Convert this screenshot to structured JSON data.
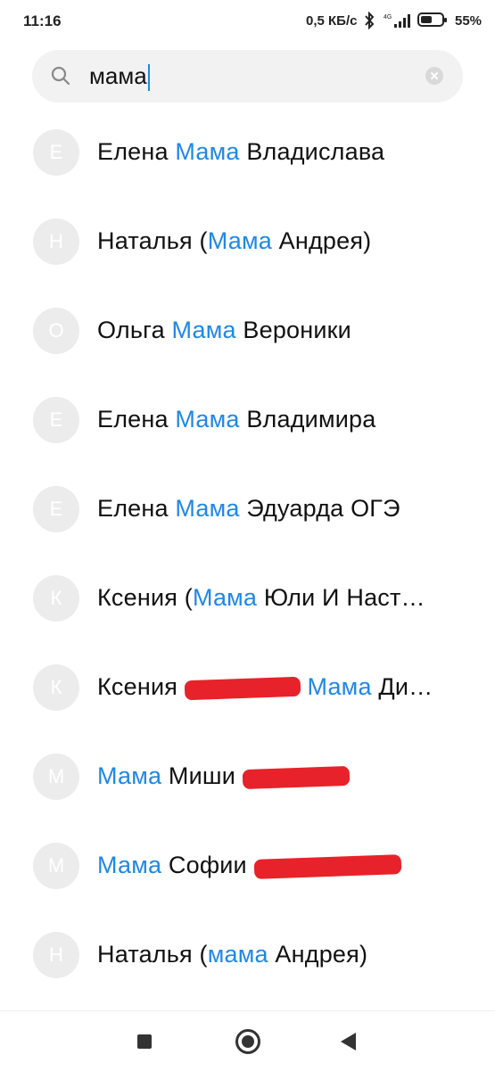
{
  "status_bar": {
    "time": "11:16",
    "net_speed": "0,5 КБ/с",
    "network_label": "4G",
    "battery_percent": "55%",
    "battery_level": 0.55
  },
  "search": {
    "query": "мама",
    "icons": {
      "search": "search-icon",
      "clear": "clear-icon"
    }
  },
  "accent_color": "#1e88e5",
  "redaction_color": "#e8222a",
  "contacts": [
    {
      "avatar": "Е",
      "parts": [
        [
          "Елена ",
          false
        ],
        [
          "Мама",
          true
        ],
        [
          " Владислава",
          false
        ]
      ]
    },
    {
      "avatar": "Н",
      "parts": [
        [
          "Наталья (",
          false
        ],
        [
          "Мама",
          true
        ],
        [
          " Андрея)",
          false
        ]
      ]
    },
    {
      "avatar": "О",
      "parts": [
        [
          "Ольга ",
          false
        ],
        [
          "Мама",
          true
        ],
        [
          " Вероники",
          false
        ]
      ]
    },
    {
      "avatar": "Е",
      "parts": [
        [
          "Елена ",
          false
        ],
        [
          "Мама",
          true
        ],
        [
          " Владимира",
          false
        ]
      ]
    },
    {
      "avatar": "Е",
      "parts": [
        [
          "Елена ",
          false
        ],
        [
          "Мама",
          true
        ],
        [
          " Эдуарда ОГЭ",
          false
        ]
      ]
    },
    {
      "avatar": "К",
      "parts": [
        [
          "Ксения (",
          false
        ],
        [
          "Мама",
          true
        ],
        [
          " Юли И Наст…",
          false
        ]
      ]
    },
    {
      "avatar": "К",
      "parts": [
        [
          "Ксения ",
          false
        ],
        [
          "__REDACT__",
          false
        ],
        [
          " ",
          false
        ],
        [
          "Мама",
          true
        ],
        [
          " Ди…",
          false
        ]
      ]
    },
    {
      "avatar": "М",
      "parts": [
        [
          "Мама",
          true
        ],
        [
          " Миши ",
          false
        ],
        [
          "__REDACT__",
          false
        ]
      ]
    },
    {
      "avatar": "М",
      "parts": [
        [
          "Мама",
          true
        ],
        [
          " Софии ",
          false
        ],
        [
          "__REDACT__",
          false
        ]
      ]
    },
    {
      "avatar": "Н",
      "parts": [
        [
          "Наталья (",
          false
        ],
        [
          "мама",
          true
        ],
        [
          " Андрея)",
          false
        ]
      ]
    }
  ],
  "nav": {
    "icons": [
      "recents-square-icon",
      "home-circle-icon",
      "back-triangle-icon"
    ]
  }
}
